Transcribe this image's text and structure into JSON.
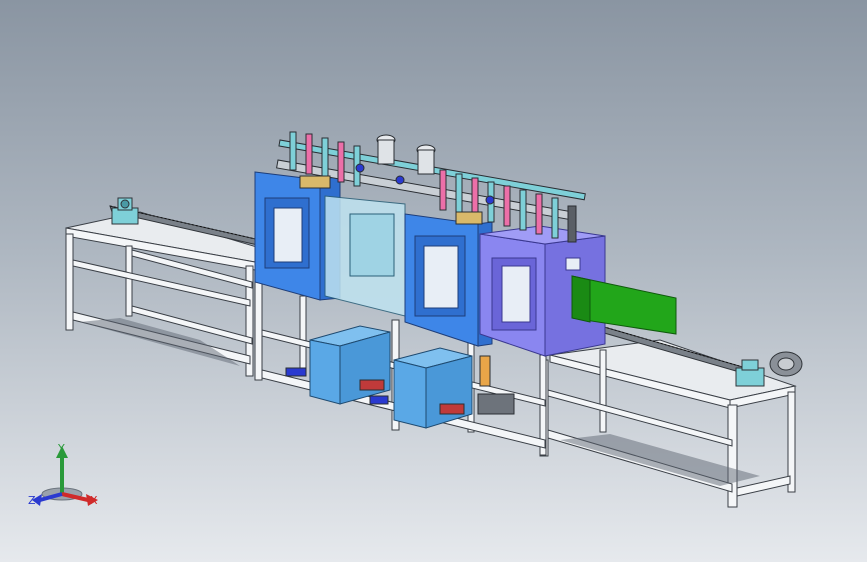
{
  "viewport": {
    "background_top": "#8a95a2",
    "background_bottom": "#e6e9ed"
  },
  "model": {
    "frame_color": "#f4f6f8",
    "frame_edge": "#3a3f46",
    "tank_color_1": "#3e86e8",
    "tank_color_2": "#8a86f0",
    "glass_color": "#bfe3f0",
    "tray_color": "#22a61a",
    "reservoir_color": "#5aa8e6",
    "fixture_color": "#7ed0d8"
  },
  "triad": {
    "x_label": "X",
    "y_label": "Y",
    "z_label": "Z",
    "x_color": "#d02a2a",
    "y_color": "#2a9a3a",
    "z_color": "#2a3ad0"
  }
}
